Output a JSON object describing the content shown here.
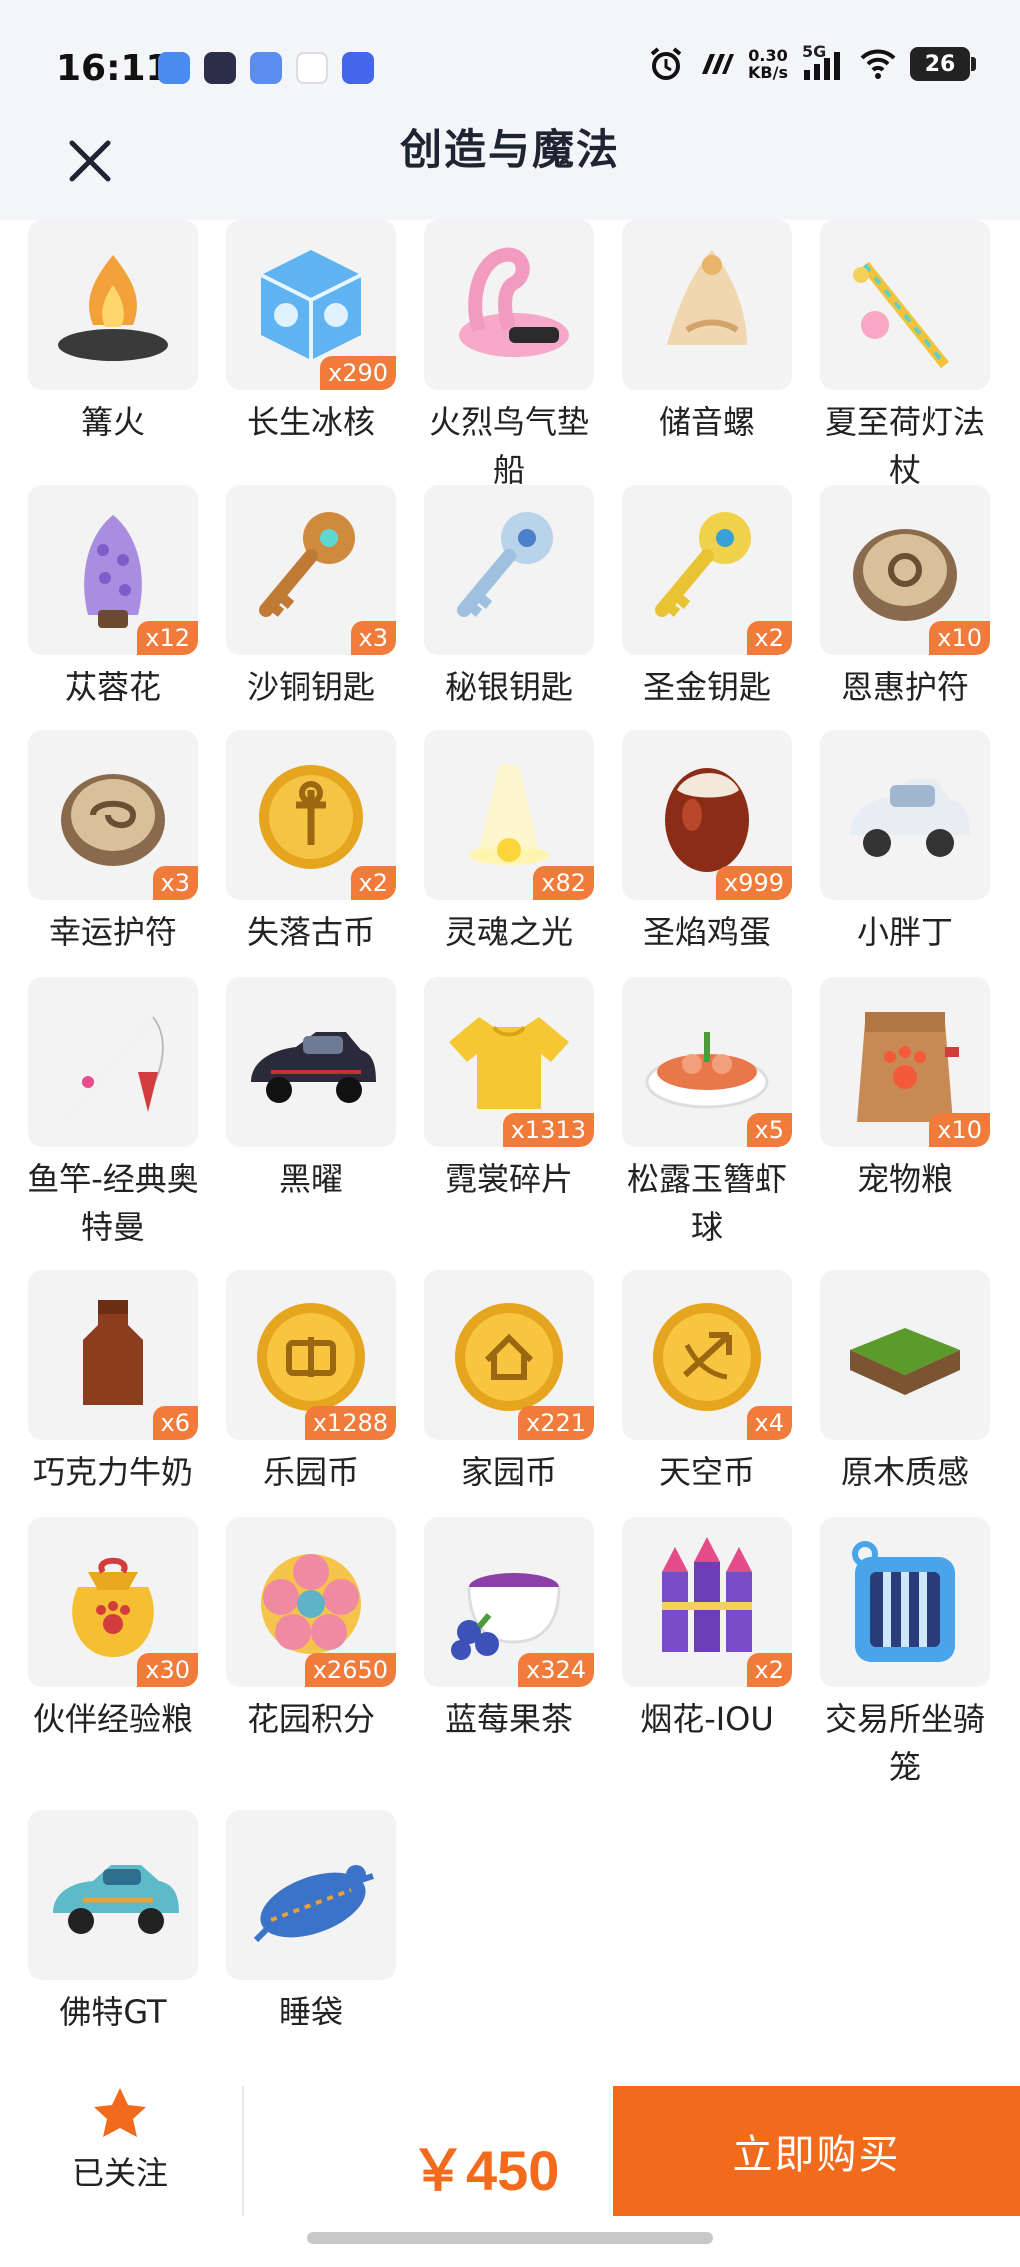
{
  "status_bar": {
    "time": "16:11",
    "net_speed_value": "0.30",
    "net_speed_unit": "KB/s",
    "network": "5G",
    "battery": "26",
    "app_icons": [
      "app-icon-blue-leaf",
      "app-icon-tv",
      "app-icon-bag",
      "app-icon-maps",
      "app-icon-vivo"
    ]
  },
  "header": {
    "title": "创造与魔法",
    "back_icon": "close-icon"
  },
  "items": [
    {
      "name": "篝火",
      "count": ""
    },
    {
      "name": "长生冰核",
      "count": "x290"
    },
    {
      "name": "火烈鸟气垫船",
      "count": ""
    },
    {
      "name": "储音螺",
      "count": ""
    },
    {
      "name": "夏至荷灯法杖",
      "count": ""
    },
    {
      "name": "苁蓉花",
      "count": "x12"
    },
    {
      "name": "沙铜钥匙",
      "count": "x3"
    },
    {
      "name": "秘银钥匙",
      "count": ""
    },
    {
      "name": "圣金钥匙",
      "count": "x2"
    },
    {
      "name": "恩惠护符",
      "count": "x10"
    },
    {
      "name": "幸运护符",
      "count": "x3"
    },
    {
      "name": "失落古币",
      "count": "x2"
    },
    {
      "name": "灵魂之光",
      "count": "x82"
    },
    {
      "name": "圣焰鸡蛋",
      "count": "x999"
    },
    {
      "name": "小胖丁",
      "count": ""
    },
    {
      "name": "鱼竿-经典奥特曼",
      "count": ""
    },
    {
      "name": "黑曜",
      "count": ""
    },
    {
      "name": "霓裳碎片",
      "count": "x1313"
    },
    {
      "name": "松露玉簪虾球",
      "count": "x5"
    },
    {
      "name": "宠物粮",
      "count": "x10"
    },
    {
      "name": "巧克力牛奶",
      "count": "x6"
    },
    {
      "name": "乐园币",
      "count": "x1288"
    },
    {
      "name": "家园币",
      "count": "x221"
    },
    {
      "name": "天空币",
      "count": "x4"
    },
    {
      "name": "原木质感",
      "count": ""
    },
    {
      "name": "伙伴经验粮",
      "count": "x30"
    },
    {
      "name": "花园积分",
      "count": "x2650"
    },
    {
      "name": "蓝莓果茶",
      "count": "x324"
    },
    {
      "name": "烟花-IOU",
      "count": "x2"
    },
    {
      "name": "交易所坐骑笼",
      "count": ""
    },
    {
      "name": "佛特GT",
      "count": ""
    },
    {
      "name": "睡袋",
      "count": ""
    }
  ],
  "bottom_bar": {
    "follow_label": "已关注",
    "follow_icon": "star-icon",
    "price": "￥450",
    "buy_label": "立即购买"
  },
  "colors": {
    "accent": "#f26a1b",
    "badge": "#f07b3a",
    "tile_bg": "#f3f3f4",
    "header_bg": "#f4f5f8"
  }
}
